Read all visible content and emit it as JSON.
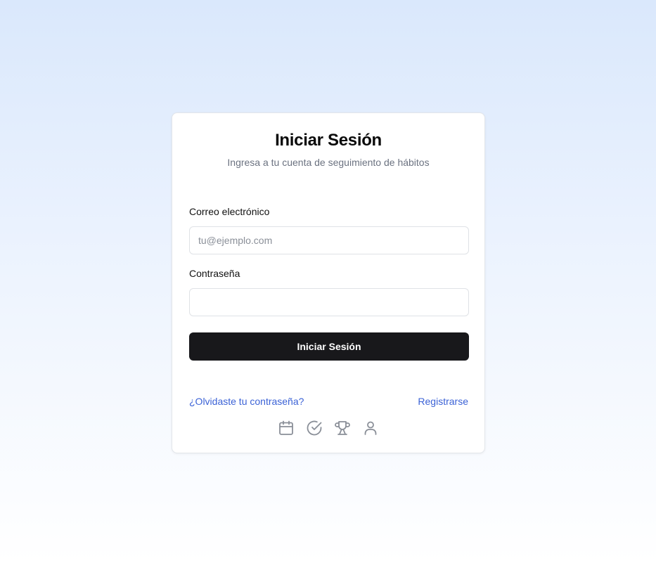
{
  "login": {
    "title": "Iniciar Sesión",
    "subtitle": "Ingresa a tu cuenta de seguimiento de hábitos",
    "email": {
      "label": "Correo electrónico",
      "placeholder": "tu@ejemplo.com",
      "value": ""
    },
    "password": {
      "label": "Contraseña",
      "placeholder": "",
      "value": ""
    },
    "submit_label": "Iniciar Sesión",
    "forgot_password_label": "¿Olvidaste tu contraseña?",
    "register_label": "Registrarse",
    "feature_icons": [
      "calendar-icon",
      "check-circle-icon",
      "trophy-icon",
      "user-icon"
    ]
  },
  "colors": {
    "background_top": "#dae8fc",
    "background_bottom": "#ffffff",
    "button": "#18181b",
    "link": "#3b62d6",
    "muted_text": "#6b7280",
    "icon": "#8a8f98"
  }
}
